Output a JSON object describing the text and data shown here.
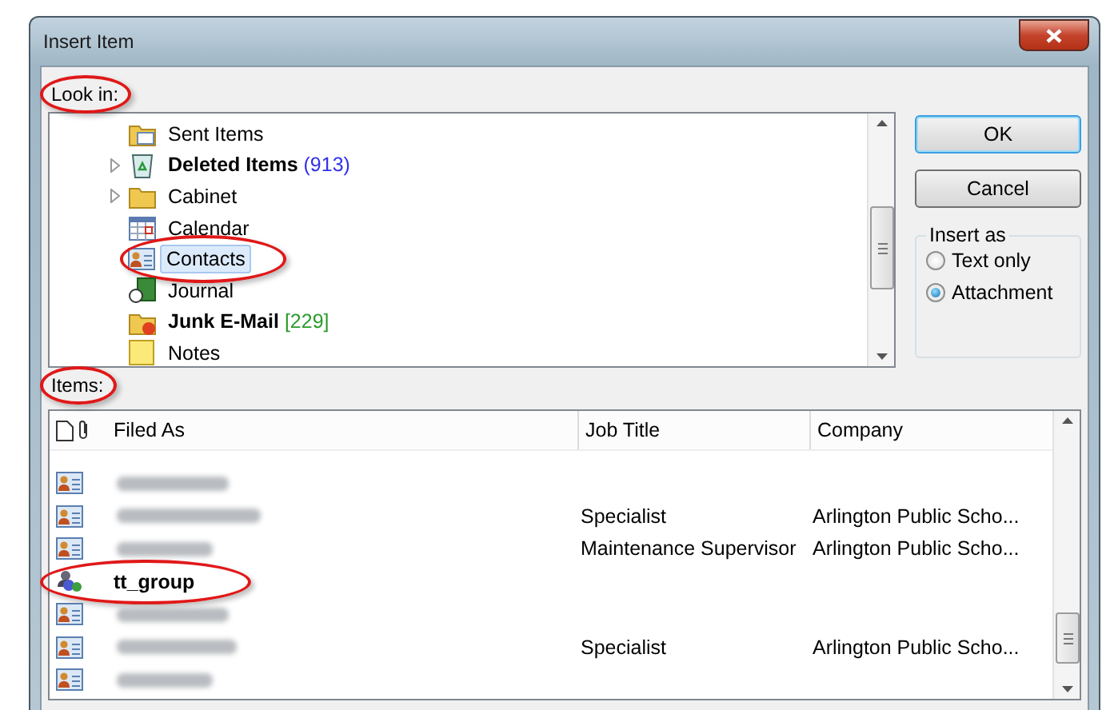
{
  "window": {
    "title": "Insert Item"
  },
  "look_in": {
    "label": "Look in:",
    "highlighted": true,
    "folders": [
      {
        "name": "Sent Items",
        "kind": "sent",
        "expandable": false,
        "bold": false,
        "selected": false,
        "highlighted": false
      },
      {
        "name": "Deleted Items",
        "count": "(913)",
        "color": "#3030e8",
        "kind": "deleted",
        "expandable": true,
        "bold": true,
        "selected": false,
        "highlighted": false
      },
      {
        "name": "Cabinet",
        "kind": "folder",
        "expandable": true,
        "bold": false,
        "selected": false,
        "highlighted": false
      },
      {
        "name": "Calendar",
        "kind": "calendar",
        "expandable": false,
        "bold": false,
        "selected": false,
        "highlighted": false
      },
      {
        "name": "Contacts",
        "kind": "contacts",
        "expandable": false,
        "bold": false,
        "selected": true,
        "highlighted": true
      },
      {
        "name": "Journal",
        "kind": "journal",
        "expandable": false,
        "bold": false,
        "selected": false,
        "highlighted": false
      },
      {
        "name": "Junk E-Mail",
        "count": "[229]",
        "color": "#2a9a2a",
        "kind": "junk",
        "expandable": false,
        "bold": true,
        "selected": false,
        "highlighted": false
      },
      {
        "name": "Notes",
        "kind": "notes",
        "expandable": false,
        "bold": false,
        "selected": false,
        "highlighted": false
      }
    ]
  },
  "buttons": [
    {
      "label": "OK",
      "default": true
    },
    {
      "label": "Cancel",
      "default": false
    }
  ],
  "insert_as": {
    "label": "Insert as",
    "options": [
      {
        "label": "Text only",
        "selected": false
      },
      {
        "label": "Attachment",
        "selected": true
      }
    ]
  },
  "items": {
    "label": "Items:",
    "highlighted": true,
    "columns": [
      "Filed As",
      "Job Title",
      "Company"
    ],
    "rows": [
      {
        "kind": "contact",
        "blurred": true,
        "highlighted": false
      },
      {
        "kind": "contact",
        "blurred": true,
        "job_title": "Specialist",
        "company": "Arlington Public Scho...",
        "highlighted": false
      },
      {
        "kind": "contact",
        "blurred": true,
        "job_title": "Maintenance Supervisor",
        "company": "Arlington Public Scho...",
        "highlighted": false
      },
      {
        "kind": "group",
        "blurred": false,
        "filed_as": "tt_group",
        "highlighted": true
      },
      {
        "kind": "contact",
        "blurred": true,
        "highlighted": false
      },
      {
        "kind": "contact",
        "blurred": true,
        "job_title": "Specialist",
        "company": "Arlington Public Scho...",
        "highlighted": false
      },
      {
        "kind": "contact",
        "blurred": true,
        "highlighted": false
      }
    ]
  }
}
